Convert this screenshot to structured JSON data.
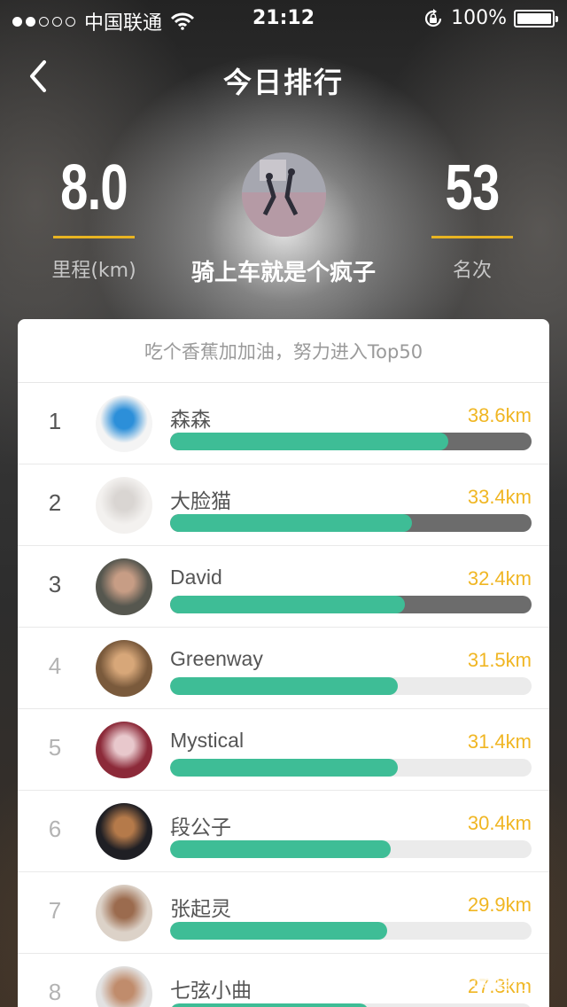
{
  "status_bar": {
    "carrier": "中国联通",
    "time": "21:12",
    "battery": "100%"
  },
  "nav": {
    "title": "今日排行"
  },
  "stats": {
    "distance_value": "8.0",
    "distance_label": "里程(km)",
    "rank_value": "53",
    "rank_label": "名次"
  },
  "profile": {
    "name": "骑上车就是个疯子"
  },
  "card": {
    "header": "吃个香蕉加加油，努力进入Top50"
  },
  "leaderboard": [
    {
      "rank": "1",
      "name": "森森",
      "distance": "38.6km",
      "progress": 0.77,
      "top": true,
      "avatar_colors": [
        "#f4f4f4",
        "#2c8fd9"
      ]
    },
    {
      "rank": "2",
      "name": "大脸猫",
      "distance": "33.4km",
      "progress": 0.67,
      "top": true,
      "avatar_colors": [
        "#f3f1ef",
        "#d9d5d2"
      ]
    },
    {
      "rank": "3",
      "name": "David",
      "distance": "32.4km",
      "progress": 0.65,
      "top": true,
      "avatar_colors": [
        "#56574f",
        "#c79d85"
      ]
    },
    {
      "rank": "4",
      "name": "Greenway",
      "distance": "31.5km",
      "progress": 0.63,
      "top": false,
      "avatar_colors": [
        "#7a5a3c",
        "#d7a779"
      ]
    },
    {
      "rank": "5",
      "name": "Mystical",
      "distance": "31.4km",
      "progress": 0.63,
      "top": false,
      "avatar_colors": [
        "#8c2a39",
        "#e8c8cc"
      ]
    },
    {
      "rank": "6",
      "name": "段公子",
      "distance": "30.4km",
      "progress": 0.61,
      "top": false,
      "avatar_colors": [
        "#1f1f24",
        "#b57a4a"
      ]
    },
    {
      "rank": "7",
      "name": "张起灵",
      "distance": "29.9km",
      "progress": 0.6,
      "top": false,
      "avatar_colors": [
        "#dcd2c8",
        "#9b6b4e"
      ]
    },
    {
      "rank": "8",
      "name": "七弦小曲",
      "distance": "27.3km",
      "progress": 0.55,
      "top": false,
      "avatar_colors": [
        "#e2e2e2",
        "#c08c6c"
      ]
    }
  ],
  "watermark": {
    "text": "华南自行车"
  },
  "colors": {
    "accent": "#e8b422",
    "progress": "#3ebd96",
    "distance": "#f0b623"
  }
}
